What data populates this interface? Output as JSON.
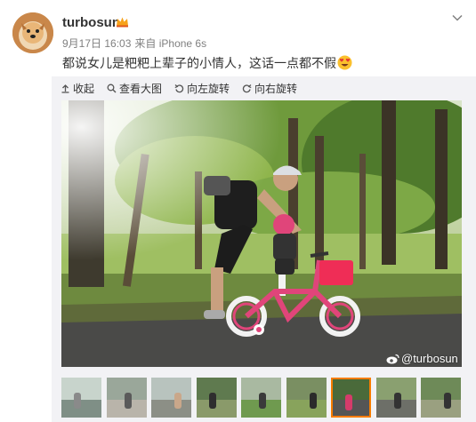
{
  "post": {
    "username": "turbosun",
    "date": "9月17日 16:03",
    "source": "来自 iPhone 6s",
    "text": "都说女儿是粑粑上辈子的小情人，这话一点都不假"
  },
  "toolbar": {
    "collapse_label": "收起",
    "view_large_label": "查看大图",
    "rotate_left_label": "向左旋转",
    "rotate_right_label": "向右旋转"
  },
  "photo": {
    "watermark": "@turbosun"
  },
  "thumbnails": [
    {
      "icon": "thumb-window",
      "top": "#c8d4cc",
      "bottom": "#7f8f86",
      "fig": "#8a8a8a",
      "active": false
    },
    {
      "icon": "thumb-table",
      "top": "#9aa79a",
      "bottom": "#b9b4aa",
      "fig": "#5a5a5a",
      "active": false
    },
    {
      "icon": "thumb-room",
      "top": "#b8c3be",
      "bottom": "#8c8f86",
      "fig": "#c9a78a",
      "active": false
    },
    {
      "icon": "thumb-park",
      "top": "#5f7a4f",
      "bottom": "#8a9a6a",
      "fig": "#2e2e2e",
      "active": false
    },
    {
      "icon": "thumb-field",
      "top": "#a9b9a1",
      "bottom": "#6f9a4f",
      "fig": "#3a3a3a",
      "active": false
    },
    {
      "icon": "thumb-trees",
      "top": "#7a8f62",
      "bottom": "#88a35c",
      "fig": "#2b2b2b",
      "active": false
    },
    {
      "icon": "thumb-bike",
      "top": "#4a6a3a",
      "bottom": "#555555",
      "fig": "#d63b6b",
      "active": true
    },
    {
      "icon": "thumb-path",
      "top": "#8aa070",
      "bottom": "#6d6f68",
      "fig": "#333333",
      "active": false
    },
    {
      "icon": "thumb-forest",
      "top": "#6e8a58",
      "bottom": "#9aa080",
      "fig": "#333333",
      "active": false
    }
  ]
}
